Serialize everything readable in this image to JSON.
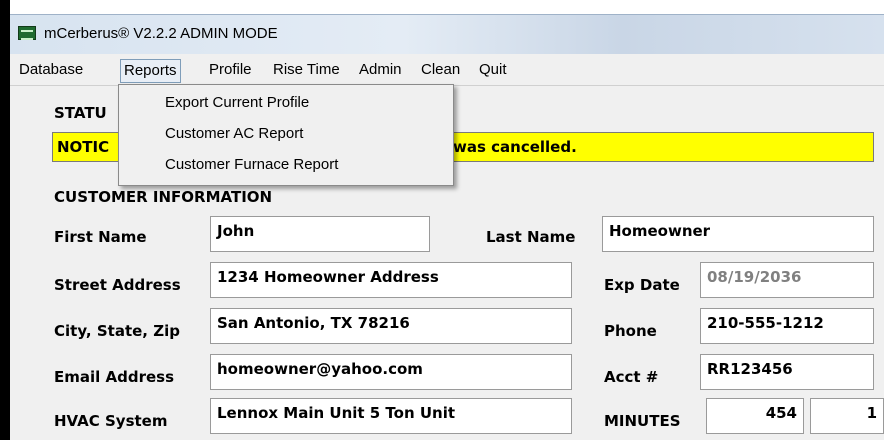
{
  "window": {
    "title": "mCerberus® V2.2.2 ADMIN MODE"
  },
  "menu": {
    "items": [
      "Database",
      "Reports",
      "Profile",
      "Rise Time",
      "Admin",
      "Clean",
      "Quit"
    ],
    "active": "Reports",
    "reports_dropdown": [
      "Export Current Profile",
      "Customer AC Report",
      "Customer Furnace Report"
    ]
  },
  "status": {
    "label": "STATU",
    "notice_prefix": "NOTIC",
    "notice_suffix": "was cancelled.",
    "notice_color": "#ffff00"
  },
  "customer": {
    "section_title": "CUSTOMER INFORMATION",
    "first_name_label": "First Name",
    "first_name": "John",
    "last_name_label": "Last Name",
    "last_name": "Homeowner",
    "street_label": "Street Address",
    "street": "1234 Homeowner Address",
    "exp_date_label": "Exp Date",
    "exp_date": "08/19/2036",
    "city_label": "City, State, Zip",
    "city": "San Antonio, TX  78216",
    "phone_label": "Phone",
    "phone": "210-555-1212",
    "email_label": "Email Address",
    "email": "homeowner@yahoo.com",
    "acct_label": "Acct #",
    "acct": "RR123456",
    "hvac_label": "HVAC System",
    "hvac": "Lennox Main Unit 5 Ton Unit",
    "minutes_label": "MINUTES",
    "minutes": "454",
    "minutes_extra": "1"
  }
}
